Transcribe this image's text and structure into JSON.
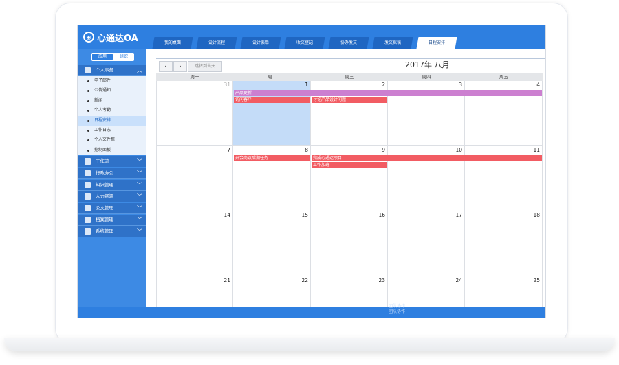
{
  "app": {
    "logo_text": "心通达OA"
  },
  "header": {
    "tabs": [
      {
        "label": "我的桌面",
        "active": false
      },
      {
        "label": "设计流程",
        "active": false
      },
      {
        "label": "设计表单",
        "active": false
      },
      {
        "label": "收文登记",
        "active": false
      },
      {
        "label": "协办发文",
        "active": false
      },
      {
        "label": "发文拟稿",
        "active": false
      },
      {
        "label": "日程安排",
        "active": true
      }
    ]
  },
  "sidebar": {
    "switch": {
      "left": "应用",
      "right": "组织"
    },
    "expanded_section": {
      "label": "个人事务",
      "icon": "person-icon"
    },
    "sub_items": [
      {
        "label": "电子邮件",
        "selected": false
      },
      {
        "label": "公告通知",
        "selected": false
      },
      {
        "label": "新闻",
        "selected": false
      },
      {
        "label": "个人考勤",
        "selected": false
      },
      {
        "label": "日程安排",
        "selected": true
      },
      {
        "label": "工作日志",
        "selected": false
      },
      {
        "label": "个人文件柜",
        "selected": false
      },
      {
        "label": "控制面板",
        "selected": false
      }
    ],
    "sections": [
      {
        "label": "工作流",
        "icon": "table-icon"
      },
      {
        "label": "行政办公",
        "icon": "user-icon"
      },
      {
        "label": "知识管理",
        "icon": "book-icon"
      },
      {
        "label": "人力资源",
        "icon": "people-icon"
      },
      {
        "label": "公文管理",
        "icon": "building-icon"
      },
      {
        "label": "档案管理",
        "icon": "archive-icon"
      },
      {
        "label": "系统管理",
        "icon": "monitor-icon"
      }
    ]
  },
  "calendar": {
    "title": "2017年 八月",
    "prev_label": "‹",
    "next_label": "›",
    "today_label": "跳转到当天",
    "weekdays": [
      "周一",
      "周二",
      "周三",
      "周四",
      "周五"
    ],
    "weeks": [
      [
        {
          "d": "31",
          "other": true
        },
        {
          "d": "1",
          "today": true
        },
        {
          "d": "2"
        },
        {
          "d": "3"
        },
        {
          "d": "4"
        }
      ],
      [
        {
          "d": "7"
        },
        {
          "d": "8"
        },
        {
          "d": "9"
        },
        {
          "d": "10"
        },
        {
          "d": "11"
        }
      ],
      [
        {
          "d": "14"
        },
        {
          "d": "15"
        },
        {
          "d": "16"
        },
        {
          "d": "17"
        },
        {
          "d": "18"
        }
      ],
      [
        {
          "d": "21"
        },
        {
          "d": "22"
        },
        {
          "d": "23"
        },
        {
          "d": "24"
        },
        {
          "d": "25"
        }
      ]
    ],
    "events": [
      {
        "title": "产品更新",
        "week": 0,
        "start": 1,
        "end": 4,
        "row": 0,
        "color": "#cc7fd0"
      },
      {
        "title": "访问客户",
        "week": 0,
        "start": 1,
        "end": 1,
        "row": 1,
        "color": "#f25c63"
      },
      {
        "title": "讨论产品设计问题",
        "week": 0,
        "start": 2,
        "end": 2,
        "row": 1,
        "color": "#f25c63"
      },
      {
        "title": "开会商议后期任务",
        "week": 1,
        "start": 1,
        "end": 1,
        "row": 0,
        "color": "#f25c63"
      },
      {
        "title": "完成心通达项目",
        "week": 1,
        "start": 2,
        "end": 4,
        "row": 0,
        "color": "#f25c63"
      },
      {
        "title": "工作加班",
        "week": 1,
        "start": 2,
        "end": 2,
        "row": 1,
        "color": "#f25c63"
      }
    ]
  },
  "footer": {
    "line1": "团队协作",
    "line2": "团队协作"
  }
}
